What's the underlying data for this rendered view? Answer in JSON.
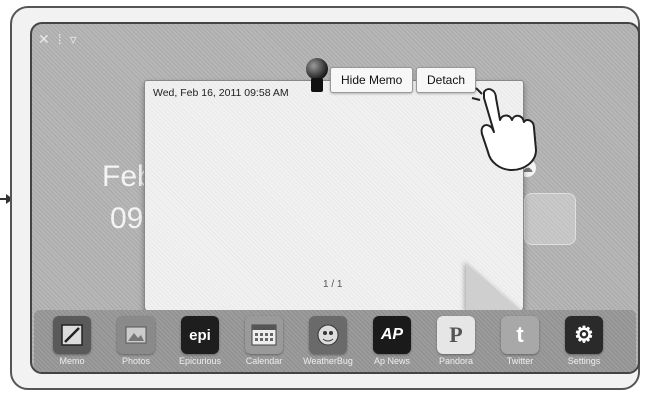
{
  "status_bar": {
    "icons": [
      "wifi-icon",
      "signal-icon",
      "notification-icon"
    ]
  },
  "home": {
    "date_partial": "Feb",
    "time_partial": "09"
  },
  "memo": {
    "timestamp": "Wed, Feb 16, 2011 09:58 AM",
    "hide_label": "Hide Memo",
    "detach_label": "Detach",
    "page_indicator": "1 / 1"
  },
  "dock": {
    "apps": [
      {
        "label": "Memo",
        "icon": "memo-icon",
        "glyph": ""
      },
      {
        "label": "Photos",
        "icon": "photos-icon",
        "glyph": ""
      },
      {
        "label": "Epicurious",
        "icon": "epi-icon",
        "glyph": "epi"
      },
      {
        "label": "Calendar",
        "icon": "calendar-icon",
        "glyph": ""
      },
      {
        "label": "WeatherBug",
        "icon": "weatherbug-icon",
        "glyph": ""
      },
      {
        "label": "Ap News",
        "icon": "ap-news-icon",
        "glyph": "AP"
      },
      {
        "label": "Pandora",
        "icon": "pandora-icon",
        "glyph": "P"
      },
      {
        "label": "Twitter",
        "icon": "twitter-icon",
        "glyph": "t"
      },
      {
        "label": "Settings",
        "icon": "settings-icon",
        "glyph": "⚙"
      }
    ]
  }
}
